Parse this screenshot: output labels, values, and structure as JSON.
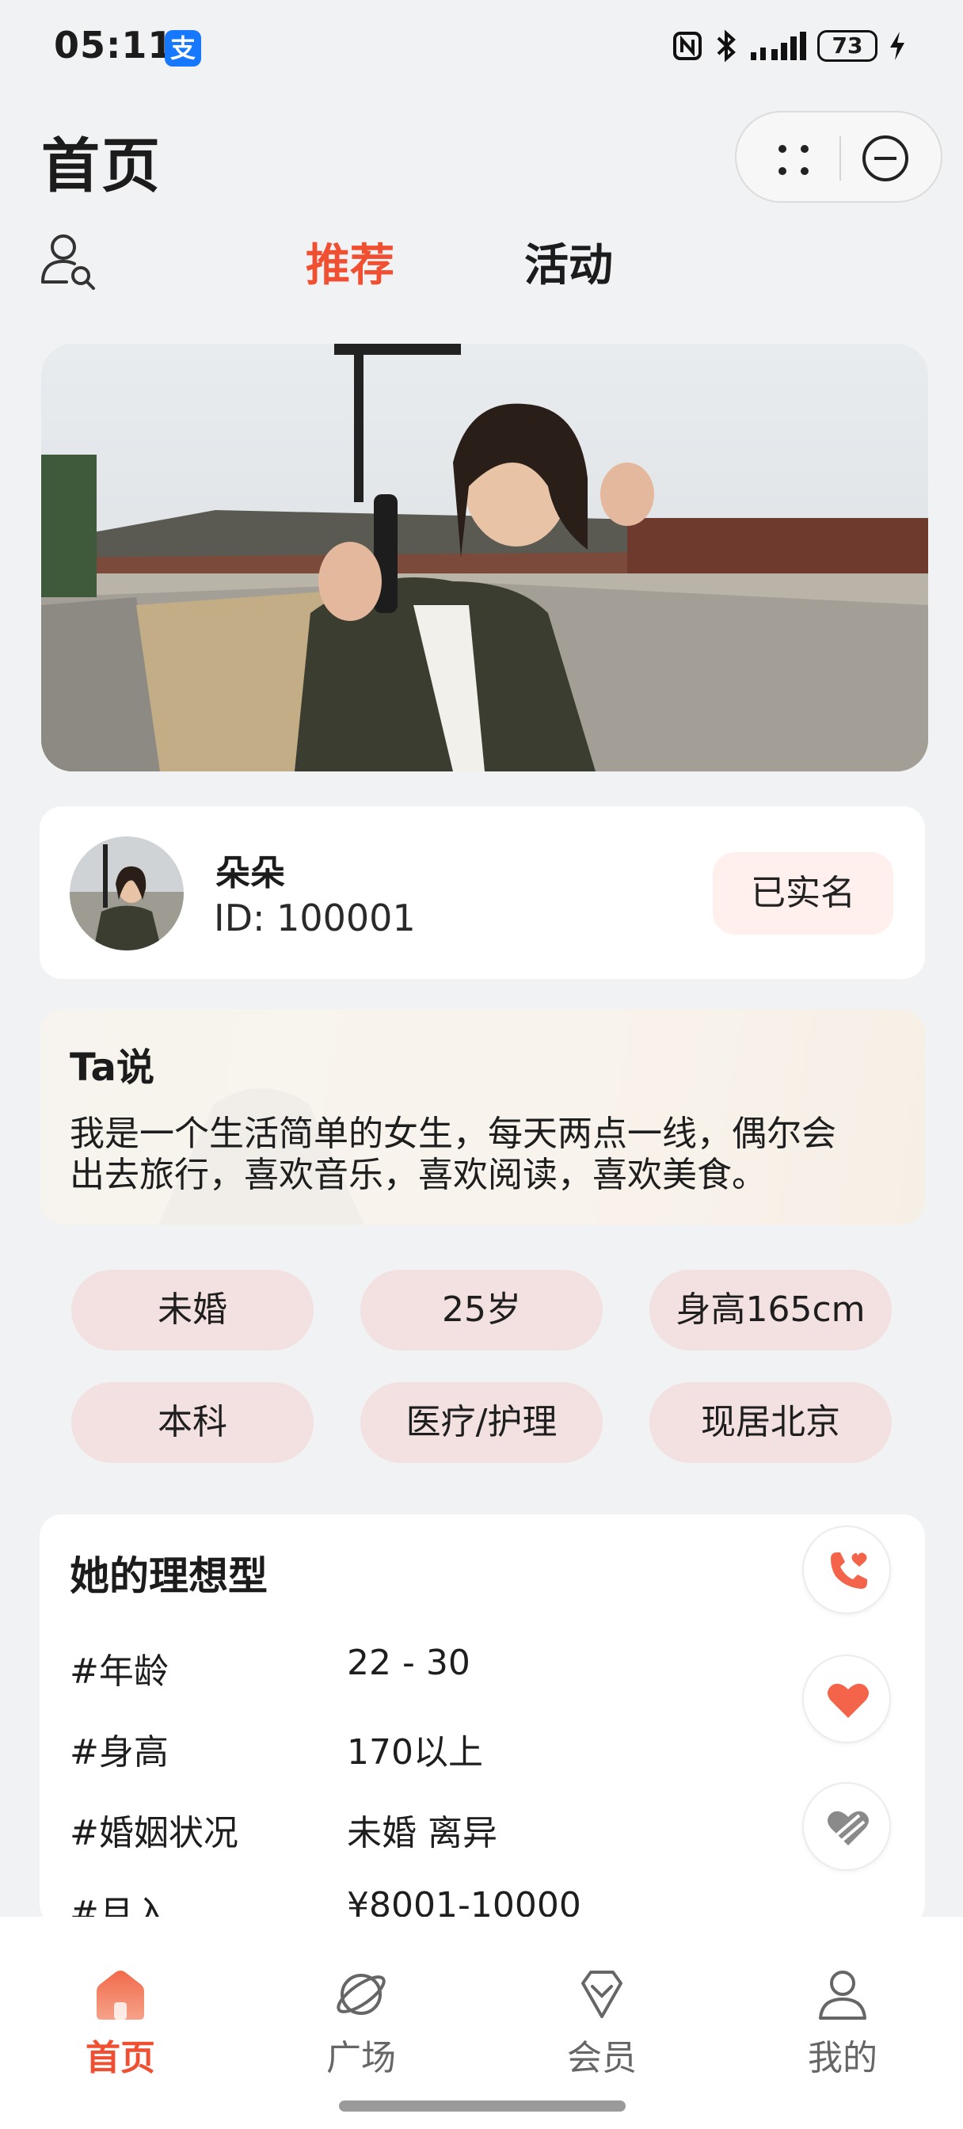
{
  "status_bar": {
    "time": "05:11",
    "alipay_icon_text": "支",
    "battery": "73"
  },
  "header": {
    "title": "首页"
  },
  "tabs": [
    {
      "label": "推荐",
      "active": true
    },
    {
      "label": "活动",
      "active": false
    }
  ],
  "profile": {
    "name": "朵朵",
    "id_text": "ID: 100001",
    "verified_label": "已实名"
  },
  "bio": {
    "title": "Ta说",
    "line1": "我是一个生活简单的女生，每天两点一线，偶尔会",
    "line2": "出去旅行，喜欢音乐，喜欢阅读，喜欢美食。"
  },
  "tags": [
    "未婚",
    "25岁",
    "身高165cm",
    "本科",
    "医疗/护理",
    "现居北京"
  ],
  "ideal": {
    "title": "她的理想型",
    "rows": [
      {
        "label": "#年龄",
        "value": "22 - 30"
      },
      {
        "label": "#身高",
        "value": "170以上"
      },
      {
        "label": "#婚姻状况",
        "value": "未婚  离异"
      },
      {
        "label": "#月入",
        "value": "¥8001-10000"
      }
    ],
    "actions": [
      "phone-heart-icon",
      "heart-icon",
      "broken-heart-icon"
    ]
  },
  "nav": [
    {
      "label": "首页",
      "icon": "home-icon",
      "active": true
    },
    {
      "label": "广场",
      "icon": "planet-icon",
      "active": false
    },
    {
      "label": "会员",
      "icon": "diamond-icon",
      "active": false
    },
    {
      "label": "我的",
      "icon": "user-icon",
      "active": false
    }
  ],
  "colors": {
    "accent": "#f04f32",
    "tag_bg": "#f3e1e1",
    "page_bg": "#f1f2f4"
  }
}
